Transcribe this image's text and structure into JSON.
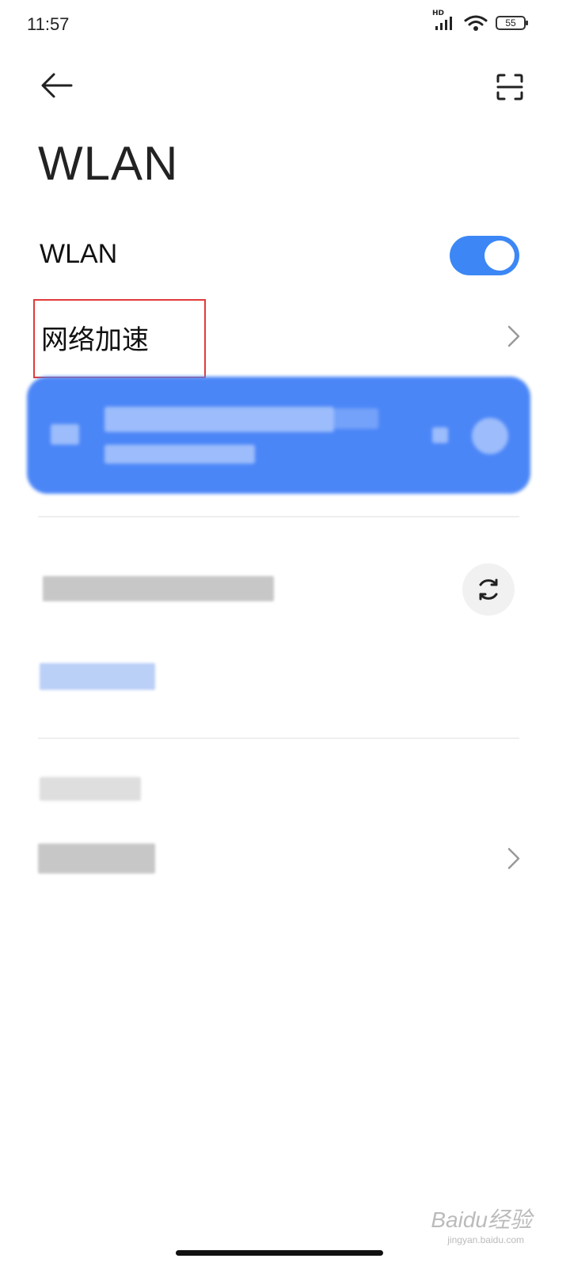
{
  "status_bar": {
    "time": "11:57",
    "network_badge": "HD",
    "battery": "55"
  },
  "header": {
    "back_icon": "arrow-left-icon",
    "scan_icon": "qr-scan-icon"
  },
  "page": {
    "title": "WLAN"
  },
  "settings": {
    "wlan_toggle": {
      "label": "WLAN",
      "enabled": true,
      "accent": "#3c87f5"
    },
    "network_acceleration": {
      "label": "网络加速",
      "highlight_color": "#e23b3b"
    }
  },
  "connected_network": {
    "accent": "#4b86f7"
  },
  "watermark": {
    "brand": "Baidu经验",
    "url": "jingyan.baidu.com"
  }
}
